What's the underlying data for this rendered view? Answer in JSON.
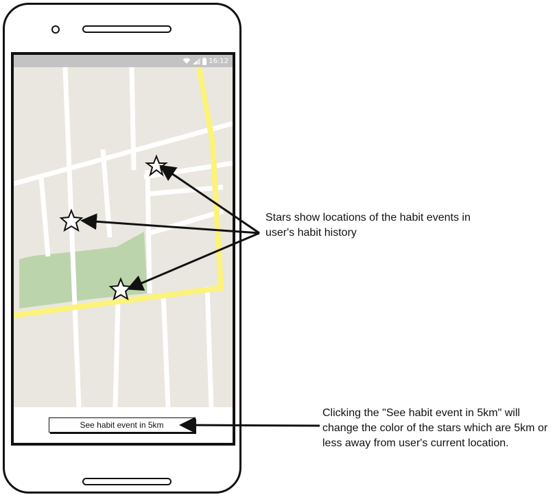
{
  "status_bar": {
    "time": "16:12",
    "icons": [
      "wifi-icon",
      "signal-icon",
      "battery-icon"
    ],
    "background": "#c3c3c3"
  },
  "map": {
    "background": "#eae7e0",
    "road_color": "#ffffff",
    "highway_color": "#fcf37a",
    "park_color": "#bcd4ab",
    "markers": [
      {
        "icon": "star-icon"
      },
      {
        "icon": "star-icon"
      },
      {
        "icon": "star-icon"
      }
    ]
  },
  "bottom": {
    "button_label": "See habit event in 5km"
  },
  "annotations": {
    "stars_note": "Stars show locations of the habit events in user's habit history",
    "button_note": "Clicking the \"See habit event in 5km\" will change the color of the stars which are 5km or less away from user's current location."
  }
}
